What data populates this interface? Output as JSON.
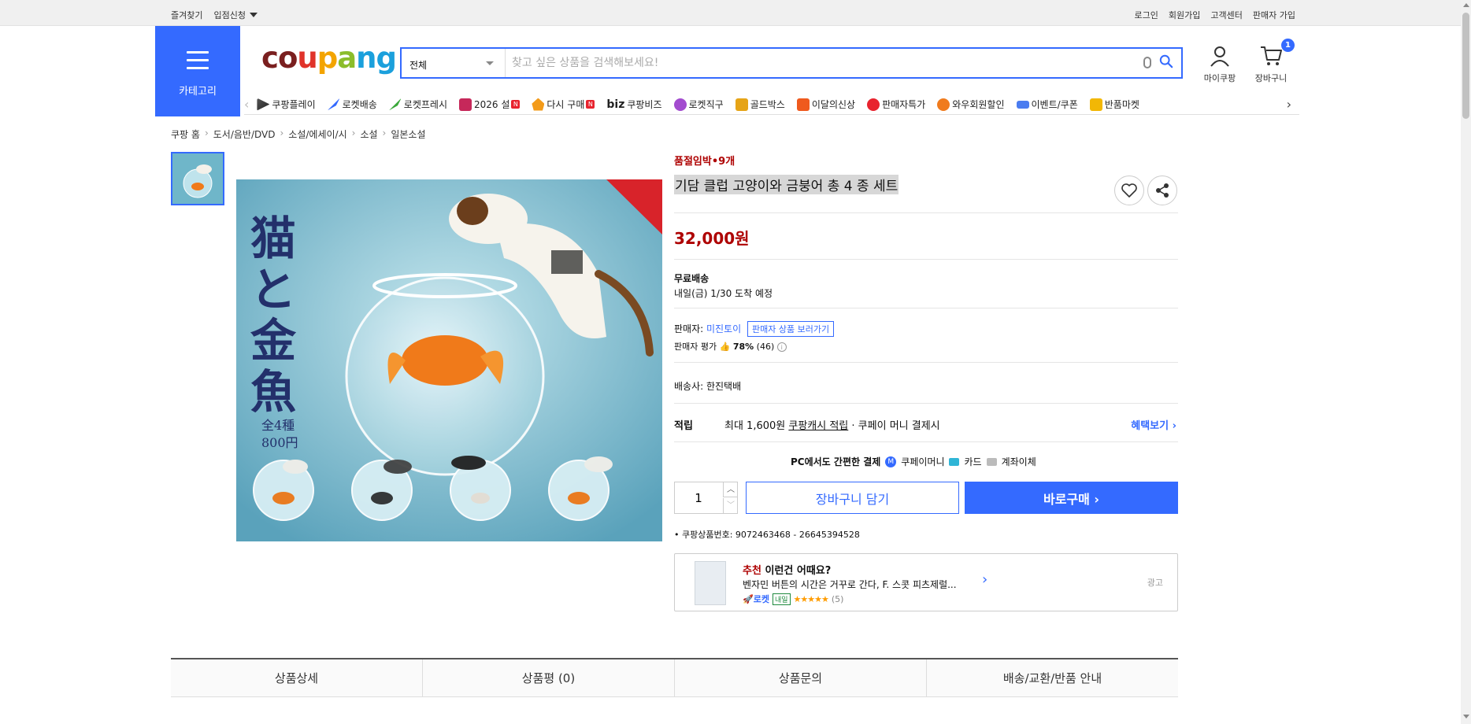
{
  "topbar": {
    "bookmark": "즐겨찾기",
    "seller_apply": "입점신청",
    "login": "로그인",
    "signup": "회원가입",
    "customer_center": "고객센터",
    "seller_signup": "판매자 가입"
  },
  "header": {
    "category_label": "카테고리",
    "logo": "coupang",
    "search_category": "전체",
    "search_placeholder": "찾고 싶은 상품을 검색해보세요!",
    "my_coupang": "마이쿠팡",
    "cart": "장바구니",
    "cart_count": "1"
  },
  "nav": {
    "items": [
      "쿠팡플레이",
      "로켓배송",
      "로켓프레시",
      "2026 설",
      "다시 구매",
      "쿠팡비즈",
      "로켓직구",
      "골드박스",
      "이달의신상",
      "판매자특가",
      "와우회원할인",
      "이벤트/쿠폰",
      "반품마켓"
    ],
    "biz_prefix": "biz",
    "new_badge": "N"
  },
  "breadcrumb": [
    "쿠팡 홈",
    "도서/음반/DVD",
    "소설/에세이/시",
    "소설",
    "일본소설"
  ],
  "product": {
    "soldout_notice": "품절임박•9개",
    "title": "기담 클럽 고양이와 금붕어 총 4 종 세트",
    "price": "32,000원",
    "shipping_title": "무료배송",
    "shipping_eta": "내일(금) 1/30 도착 예정",
    "seller_label": "판매자:",
    "seller_name": "미진토이",
    "seller_btn": "판매자 상품 보러가기",
    "seller_rating_label": "판매자 평가",
    "seller_rating_pct": "78%",
    "seller_rating_cnt": "(46)",
    "carrier": "배송사:  한진택배",
    "reward_label": "적립",
    "reward_text": "최대 1,600원",
    "reward_link": "쿠팡캐시 적립",
    "reward_suffix": "· 쿠페이 머니 결제시",
    "reward_more": "혜택보기 ›",
    "pay_title": "PC에서도 간편한 결제",
    "pay_money": "쿠페이머니",
    "pay_card": "카드",
    "pay_account": "계좌이체",
    "qty": "1",
    "cart_btn": "장바구니 담기",
    "buy_btn": "바로구매 ›",
    "product_no": "쿠팡상품번호: 9072463468 - 26645394528"
  },
  "image": {
    "jp_title": "猫と金魚",
    "jp_sub": "全4種",
    "jp_price": "800円"
  },
  "ad": {
    "rec": "추천",
    "headline": " 이런건 어때요?",
    "title": "벤자민 버튼의 시간은 거꾸로 간다, F. 스콧 피츠제럴...",
    "rocket": "로켓",
    "tomorrow": "내일",
    "stars": "★★★★★",
    "count": "(5)",
    "ad_label": "광고"
  },
  "tabs": [
    "상품상세",
    "상품평 (0)",
    "상품문의",
    "배송/교환/반품 안내"
  ],
  "colors": {
    "accent": "#346aff",
    "price": "#ae0000"
  }
}
